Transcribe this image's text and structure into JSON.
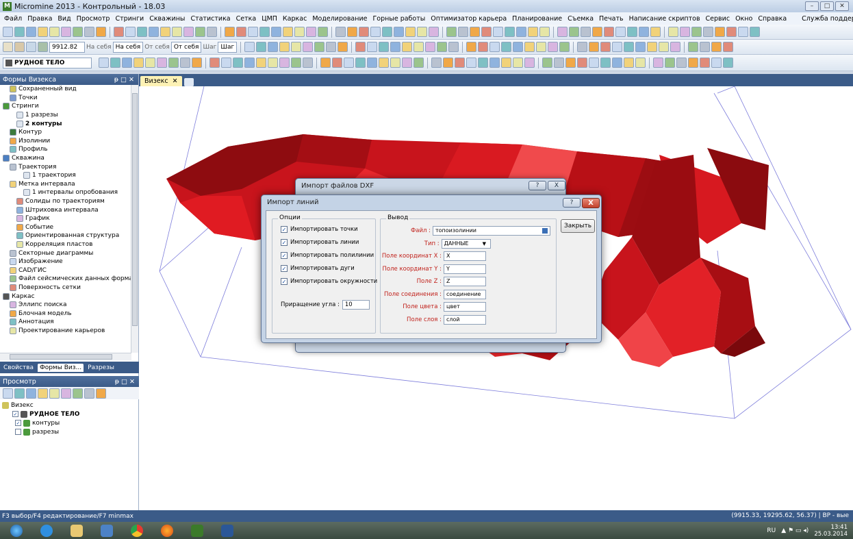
{
  "window": {
    "title": "Micromine 2013 - Контрольный - 18.03",
    "logo": "M"
  },
  "menu": [
    "Файл",
    "Правка",
    "Вид",
    "Просмотр",
    "Стринги",
    "Скважины",
    "Статистика",
    "Сетка",
    "ЦМП",
    "Каркас",
    "Моделирование",
    "Горные работы",
    "Оптимизатор карьера",
    "Планирование",
    "Съемка",
    "Печать",
    "Написание скриптов",
    "Сервис",
    "Окно",
    "Справка"
  ],
  "menu_support": "Служба поддержки",
  "toolbar2": {
    "coord": "9912.82",
    "na_sebya": "На себя",
    "ot_sebya": "От себя",
    "shag": "Шаг",
    "combo_na": "На себя",
    "combo_ot": "От себя",
    "combo_shag": "Шаг"
  },
  "toolbar3": {
    "object_combo": "РУДНОЕ ТЕЛО"
  },
  "left_panel": {
    "title": "Формы Визекса",
    "tree": [
      {
        "label": "Сохраненный вид",
        "indent": 1,
        "icon": "saved-view-icon",
        "bold": false
      },
      {
        "label": "Точки",
        "indent": 1,
        "icon": "points-icon",
        "bold": false
      },
      {
        "label": "Стринги",
        "indent": 0,
        "icon": "strings-icon",
        "bold": false
      },
      {
        "label": "1 разрезы",
        "indent": 2,
        "icon": "table-icon",
        "bold": false
      },
      {
        "label": "2 контуры",
        "indent": 2,
        "icon": "table-icon",
        "bold": true
      },
      {
        "label": "Контур",
        "indent": 1,
        "icon": "contour-icon",
        "bold": false
      },
      {
        "label": "Изолинии",
        "indent": 1,
        "icon": "isolines-icon",
        "bold": false
      },
      {
        "label": "Профиль",
        "indent": 1,
        "icon": "profile-icon",
        "bold": false
      },
      {
        "label": "Скважина",
        "indent": 0,
        "icon": "drillhole-icon",
        "bold": false
      },
      {
        "label": "Траектория",
        "indent": 1,
        "icon": "trajectory-icon",
        "bold": false
      },
      {
        "label": "1 траектория",
        "indent": 3,
        "icon": "table-icon",
        "bold": false
      },
      {
        "label": "Метка интервала",
        "indent": 1,
        "icon": "interval-label-icon",
        "bold": false
      },
      {
        "label": "1 интервалы опробования",
        "indent": 3,
        "icon": "table-icon",
        "bold": false
      },
      {
        "label": "Солиды по траекториям",
        "indent": 2,
        "icon": "solids-icon",
        "bold": false
      },
      {
        "label": "Штриховка интервала",
        "indent": 2,
        "icon": "hatch-icon",
        "bold": false
      },
      {
        "label": "График",
        "indent": 2,
        "icon": "graph-icon",
        "bold": false
      },
      {
        "label": "Событие",
        "indent": 2,
        "icon": "event-icon",
        "bold": false
      },
      {
        "label": "Ориентированная структура",
        "indent": 2,
        "icon": "structure-icon",
        "bold": false
      },
      {
        "label": "Корреляция пластов",
        "indent": 2,
        "icon": "correlation-icon",
        "bold": false
      },
      {
        "label": "Секторные диаграммы",
        "indent": 1,
        "icon": "pie-icon",
        "bold": false
      },
      {
        "label": "Изображение",
        "indent": 1,
        "icon": "image-icon",
        "bold": false
      },
      {
        "label": "САD/ГИС",
        "indent": 1,
        "icon": "gis-icon",
        "bold": false
      },
      {
        "label": "Файл сейсмических данных форма",
        "indent": 1,
        "icon": "seismic-icon",
        "bold": false
      },
      {
        "label": "Поверхность сетки",
        "indent": 1,
        "icon": "grid-surface-icon",
        "bold": false
      },
      {
        "label": "Каркас",
        "indent": 0,
        "icon": "wireframe-icon",
        "bold": false
      },
      {
        "label": "Эллипс поиска",
        "indent": 1,
        "icon": "ellipse-icon",
        "bold": false
      },
      {
        "label": "Блочная модель",
        "indent": 1,
        "icon": "block-model-icon",
        "bold": false
      },
      {
        "label": "Аннотация",
        "indent": 1,
        "icon": "annotation-icon",
        "bold": false
      },
      {
        "label": "Проектирование карьеров",
        "indent": 1,
        "icon": "pit-design-icon",
        "bold": false
      }
    ],
    "tabs": [
      "Свойства",
      "Формы Виз...",
      "Разрезы"
    ]
  },
  "preview_panel": {
    "title": "Просмотр",
    "root": "Визекс",
    "items": [
      {
        "label": "РУДНОЕ ТЕЛО",
        "bold": true,
        "checked": true
      },
      {
        "label": "контуры",
        "bold": false,
        "checked": true
      },
      {
        "label": "разрезы",
        "bold": false,
        "checked": false
      }
    ]
  },
  "doc_tab": {
    "label": "Визекс"
  },
  "dialog_back": {
    "title": "Импорт файлов DXF"
  },
  "dialog": {
    "title": "Импорт линий",
    "help": "?",
    "close": "X",
    "options_group": "Опции",
    "options": [
      {
        "label": "Импортировать точки",
        "checked": true
      },
      {
        "label": "Импортировать линии",
        "checked": true
      },
      {
        "label": "Импортировать полилинии",
        "checked": true
      },
      {
        "label": "Импортировать дуги",
        "checked": true
      },
      {
        "label": "Импортировать окружности",
        "checked": true
      }
    ],
    "angle_label": "Приращение угла :",
    "angle_value": "10",
    "output_group": "Вывод",
    "fields": [
      {
        "label": "Файл :",
        "value": "топоизолинии"
      },
      {
        "label": "Тип :",
        "value": "ДАННЫЕ"
      },
      {
        "label": "Поле координат X :",
        "value": "X"
      },
      {
        "label": "Поле координат Y :",
        "value": "Y"
      },
      {
        "label": "Поле Z :",
        "value": "Z"
      },
      {
        "label": "Поле соединения :",
        "value": "соединение"
      },
      {
        "label": "Поле цвета :",
        "value": "цвет"
      },
      {
        "label": "Поле слоя :",
        "value": "слой"
      }
    ],
    "close_button": "Закрыть"
  },
  "statusbar": {
    "left": "F3 выбор/F4 редактирование/F7 minmax",
    "right": "(9915.33, 19295.62, 56.37)  |  BP - вые"
  },
  "taskbar": {
    "lang": "RU",
    "time": "13:41",
    "date": "25.03.2014"
  },
  "colors": {
    "accent": "#3b5b88",
    "ore": "#d4131a",
    "ore_dark": "#7c0a0d"
  }
}
